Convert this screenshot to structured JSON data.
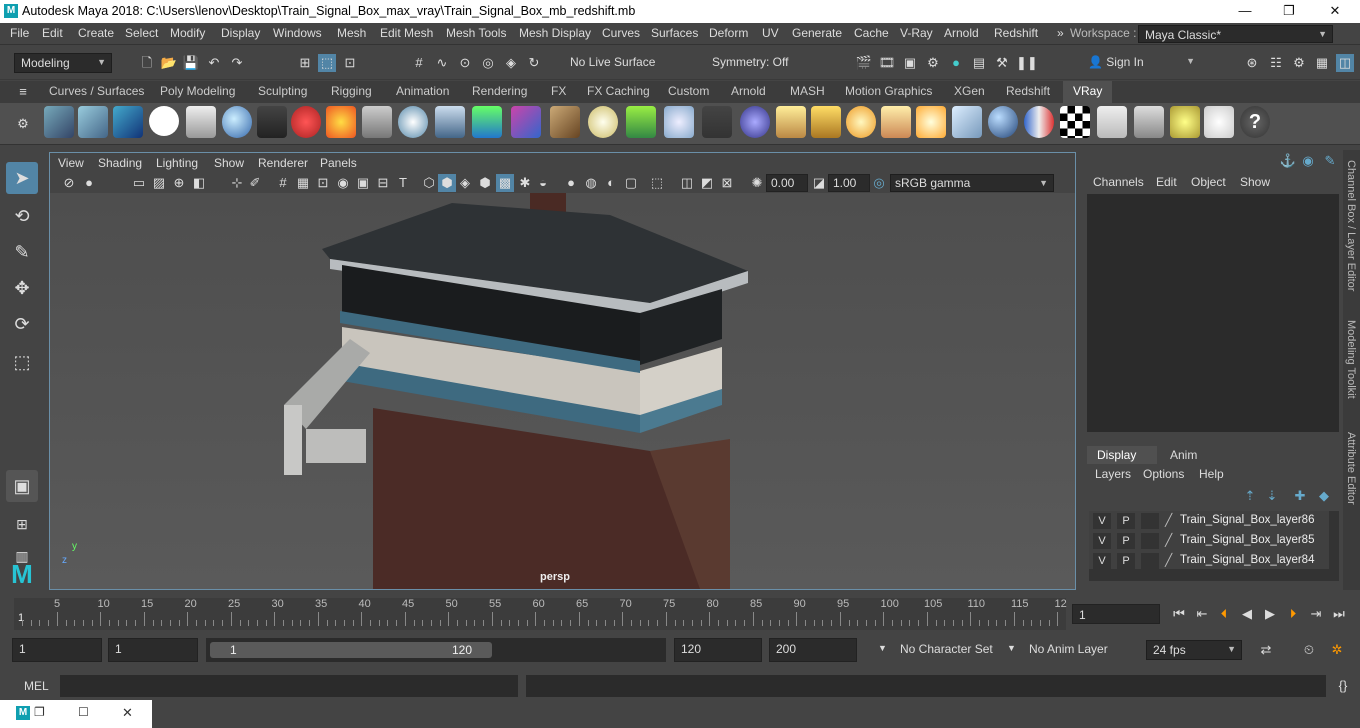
{
  "window": {
    "title": "Autodesk Maya 2018: C:\\Users\\lenov\\Desktop\\Train_Signal_Box_max_vray\\Train_Signal_Box_mb_redshift.mb",
    "logo_letter": "M",
    "minimize": "—",
    "maximize": "❐",
    "close": "✕"
  },
  "menubar": {
    "items": [
      "File",
      "Edit",
      "Create",
      "Select",
      "Modify",
      "Display",
      "Windows",
      "Mesh",
      "Edit Mesh",
      "Mesh Tools",
      "Mesh Display",
      "Curves",
      "Surfaces",
      "Deform",
      "UV",
      "Generate",
      "Cache",
      "V-Ray",
      "Arnold",
      "Redshift"
    ],
    "overflow": "»",
    "workspace_label": "Workspace :",
    "workspace_value": "Maya Classic*"
  },
  "statusline": {
    "mode": "Modeling",
    "live_surface": "No Live Surface",
    "symmetry": "Symmetry: Off",
    "sign_in": "Sign In"
  },
  "shelf_tabs": [
    "Curves / Surfaces",
    "Poly Modeling",
    "Sculpting",
    "Rigging",
    "Animation",
    "Rendering",
    "FX",
    "FX Caching",
    "Custom",
    "Arnold",
    "MASH",
    "Motion Graphics",
    "XGen",
    "Redshift",
    "VRay"
  ],
  "shelf_active_tab": "VRay",
  "panel_menu": [
    "View",
    "Shading",
    "Lighting",
    "Show",
    "Renderer",
    "Panels"
  ],
  "panel_tools": {
    "exposure": "0.00",
    "gamma": "1.00",
    "color_space": "sRGB gamma"
  },
  "viewport": {
    "camera_label": "persp",
    "axis_y": "y",
    "axis_z": "z"
  },
  "channel_box": {
    "menus": [
      "Channels",
      "Edit",
      "Object",
      "Show"
    ]
  },
  "layer_editor": {
    "tabs": [
      "Display",
      "Anim"
    ],
    "menus": [
      "Layers",
      "Options",
      "Help"
    ],
    "layers": [
      {
        "v": "V",
        "p": "P",
        "name": "Train_Signal_Box_layer86"
      },
      {
        "v": "V",
        "p": "P",
        "name": "Train_Signal_Box_layer85"
      },
      {
        "v": "V",
        "p": "P",
        "name": "Train_Signal_Box_layer84"
      }
    ]
  },
  "side_tabs": [
    "Channel Box / Layer Editor",
    "Modeling Toolkit",
    "Attribute Editor"
  ],
  "timeline": {
    "ticks": [
      "5",
      "10",
      "15",
      "20",
      "25",
      "30",
      "35",
      "40",
      "45",
      "50",
      "55",
      "60",
      "65",
      "70",
      "75",
      "80",
      "85",
      "90",
      "95",
      "100",
      "105",
      "110",
      "115",
      "12"
    ],
    "start_marker": "1",
    "current_frame": "1"
  },
  "range": {
    "start": "1",
    "playback_start": "1",
    "slider_start": "1",
    "slider_end": "120",
    "playback_end": "120",
    "end": "200",
    "character_set": "No Character Set",
    "anim_layer": "No Anim Layer",
    "fps": "24 fps"
  },
  "command_line": {
    "label": "MEL"
  },
  "colors": {
    "viewport_border": "#6a8fa8",
    "active_tab": "#5285a6"
  }
}
